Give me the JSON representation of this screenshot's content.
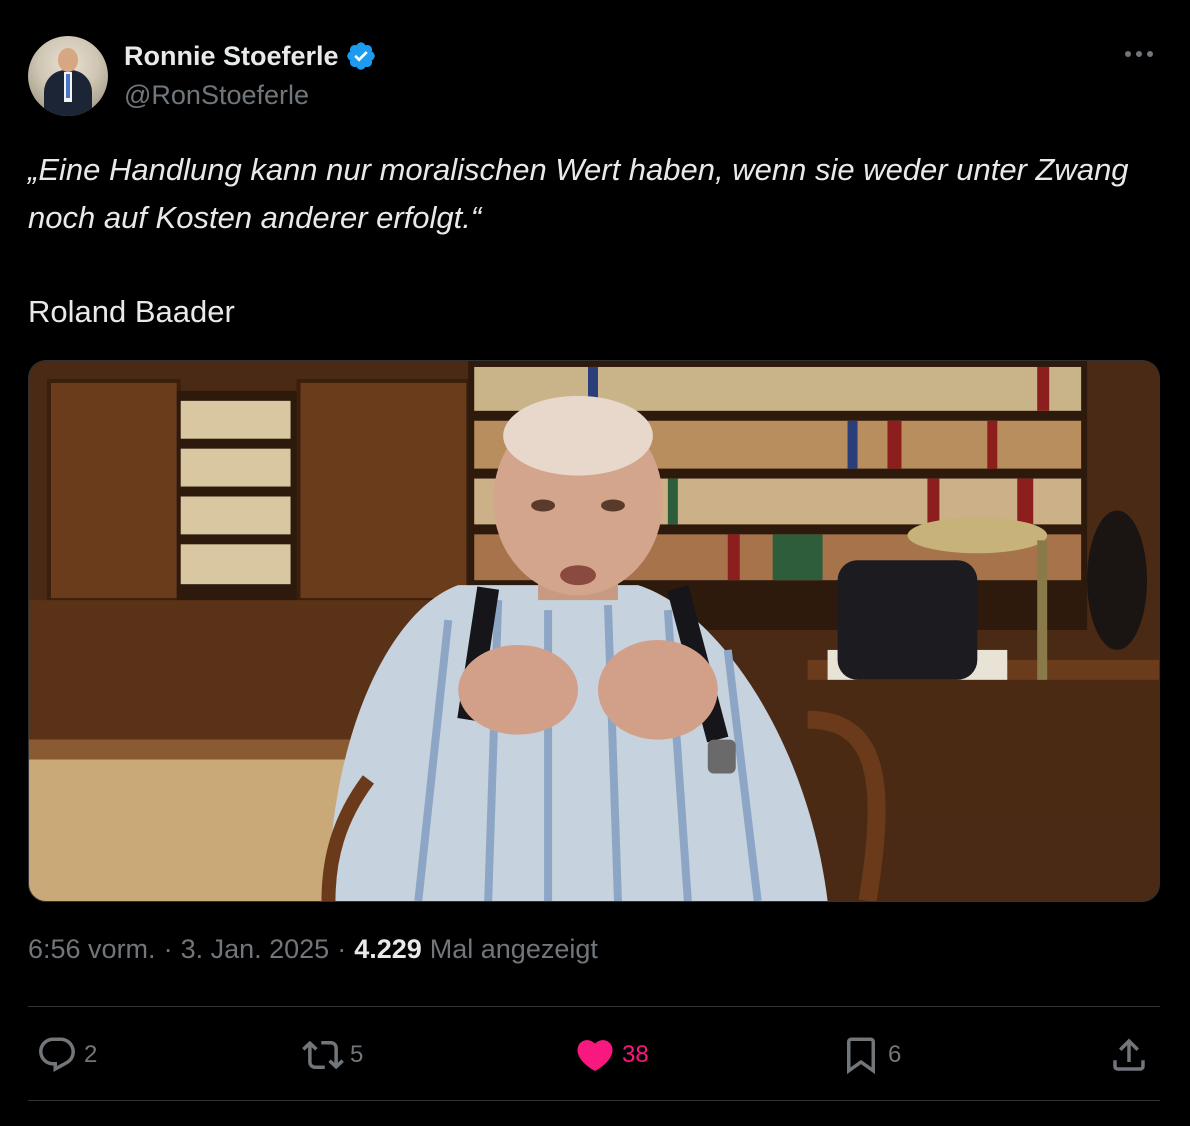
{
  "user": {
    "display_name": "Ronnie Stoeferle",
    "handle": "@RonStoeferle",
    "verified": true
  },
  "tweet": {
    "quote": "„Eine Handlung kann nur moralischen Wert haben, wenn sie weder unter Zwang noch auf Kosten anderer erfolgt.“",
    "author": "Roland Baader"
  },
  "meta": {
    "time": "6:56 vorm.",
    "sep1": "·",
    "date": "3. Jan. 2025",
    "sep2": "·",
    "views_count": "4.229",
    "views_label": "Mal angezeigt"
  },
  "actions": {
    "replies": "2",
    "retweets": "5",
    "likes": "38",
    "bookmarks": "6"
  },
  "colors": {
    "background": "#000000",
    "text": "#e7e9ea",
    "muted": "#71767b",
    "verified": "#1d9bf0",
    "like": "#f91880",
    "divider": "#2f3336"
  },
  "icons": [
    "more-icon",
    "verified-icon",
    "reply-icon",
    "retweet-icon",
    "heart-icon",
    "bookmark-icon",
    "share-icon"
  ]
}
